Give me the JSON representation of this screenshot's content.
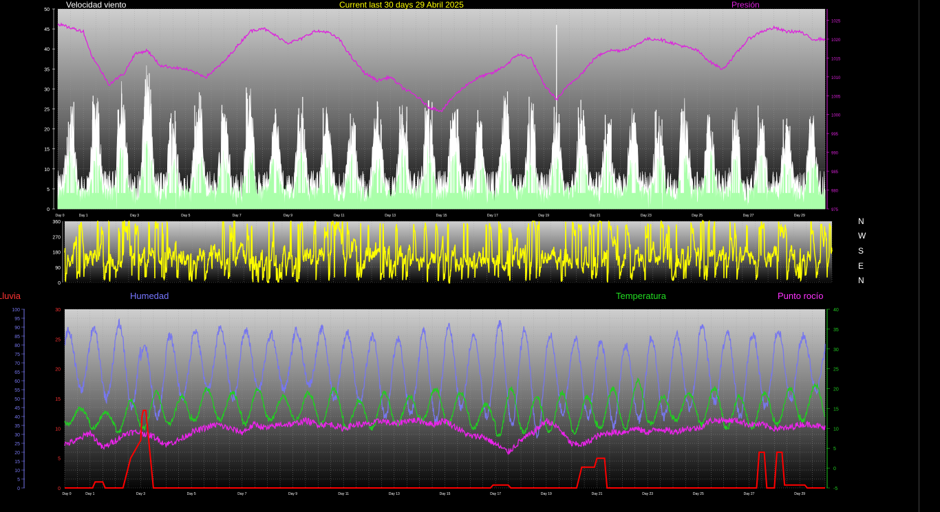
{
  "header": {
    "left_title": "Velocidad viento",
    "center_title": "Current last 30 days 29 Abril 2025",
    "right_title": "Presión"
  },
  "lower_header": {
    "rain": "Lluvia",
    "humidity": "Humedad",
    "temperature": "Temperatura",
    "dewpoint": "Punto rocío"
  },
  "compass": [
    "N",
    "W",
    "S",
    "E",
    "N"
  ],
  "colors": {
    "wind_gust": "#ffffff",
    "wind_avg": "#aaffaa",
    "pressure": "#dd22dd",
    "direction": "#ffff00",
    "humidity": "#7777ee",
    "temperature": "#22cc22",
    "dewpoint": "#ee22ee",
    "rain": "#ff0000",
    "center_title": "#ffff00",
    "rain_label": "#ff3333",
    "humidity_label": "#7777ff",
    "temperature_label": "#22dd22",
    "dewpoint_label": "#ff33ff"
  },
  "chart_data": [
    {
      "type": "line",
      "name": "wind-pressure",
      "y_left_ticks": [
        "50",
        "45",
        "40",
        "35",
        "30",
        "25",
        "20",
        "15",
        "10",
        "5",
        "0"
      ],
      "y_right_ticks": [
        "1025",
        "1020",
        "1015",
        "1010",
        "1005",
        "1000",
        "995",
        "990",
        "985",
        "980",
        "975"
      ],
      "x_ticks": [
        "Day 0",
        "Day 1",
        "Day 3",
        "Day 5",
        "Day 7",
        "Day 9",
        "Day 11",
        "Day 13",
        "Day 15",
        "Day 17",
        "Day 19",
        "Day 21",
        "Day 23",
        "Day 25",
        "Day 27",
        "Day 29"
      ],
      "ylim_left": [
        0,
        50
      ],
      "ylim_right": [
        975,
        1028
      ],
      "xlim": [
        0,
        30
      ],
      "series": [
        {
          "key": "gust",
          "daily_peaks": [
            28,
            30,
            33,
            38,
            26,
            30,
            28,
            31,
            26,
            30,
            27,
            24,
            29,
            27,
            30,
            28,
            25,
            31,
            29,
            26,
            28,
            24,
            26,
            25,
            28,
            26,
            25,
            26,
            24,
            27
          ],
          "color_key": "wind_gust"
        },
        {
          "key": "avg",
          "daily_peaks": [
            15,
            15,
            17,
            19,
            14,
            16,
            15,
            16,
            14,
            16,
            15,
            14,
            15,
            15,
            16,
            15,
            14,
            16,
            15,
            14,
            15,
            14,
            14,
            14,
            15,
            15,
            14,
            14,
            13,
            14
          ],
          "color_key": "wind_avg"
        },
        {
          "key": "pressure",
          "x": [
            0,
            0.5,
            1,
            1.3,
            2,
            2.6,
            3,
            3.5,
            4,
            5,
            5.8,
            6.5,
            7,
            7.5,
            8,
            8.5,
            9,
            9.5,
            10,
            10.5,
            11,
            11.5,
            12,
            12.5,
            13,
            13.5,
            14,
            14.5,
            15,
            15.5,
            16,
            16.5,
            17,
            17.5,
            18,
            18.5,
            19,
            19.5,
            20,
            20.5,
            21,
            21.5,
            22,
            22.5,
            23,
            23.5,
            24,
            24.5,
            25,
            25.5,
            26,
            26.5,
            27,
            27.5,
            28,
            28.5,
            29,
            29.5,
            30
          ],
          "y": [
            1024,
            1023,
            1022,
            1016,
            1008,
            1011,
            1016,
            1017,
            1013,
            1012,
            1010,
            1014,
            1018,
            1022,
            1023,
            1021,
            1019,
            1020,
            1022,
            1022,
            1020,
            1015,
            1011,
            1009,
            1010,
            1007,
            1005,
            1002,
            1001,
            1005,
            1008,
            1010,
            1011,
            1013,
            1016,
            1015,
            1008,
            1004,
            1008,
            1011,
            1015,
            1017,
            1017,
            1018,
            1020,
            1020,
            1019,
            1018,
            1017,
            1014,
            1012,
            1016,
            1020,
            1022,
            1023,
            1022,
            1022,
            1020,
            1020
          ],
          "color_key": "pressure"
        }
      ]
    },
    {
      "type": "line",
      "name": "wind-direction",
      "y_ticks": [
        "360",
        "270",
        "180",
        "90",
        "0"
      ],
      "ylim": [
        0,
        360
      ],
      "series": [
        {
          "key": "direction",
          "color_key": "direction"
        }
      ]
    },
    {
      "type": "line",
      "name": "humidity-temp-dew-rain",
      "y_hum_ticks": [
        "100",
        "95",
        "90",
        "85",
        "80",
        "75",
        "70",
        "65",
        "60",
        "55",
        "50",
        "45",
        "40",
        "35",
        "30",
        "25",
        "20",
        "15",
        "10",
        "5",
        "0"
      ],
      "y_rain_ticks": [
        "30",
        "25",
        "20",
        "15",
        "10",
        "5",
        "0"
      ],
      "y_temp_ticks": [
        "40",
        "35",
        "30",
        "25",
        "20",
        "15",
        "10",
        "5",
        "0",
        "-5"
      ],
      "x_ticks": [
        "Day 0",
        "Day 1",
        "Day 3",
        "Day 5",
        "Day 7",
        "Day 9",
        "Day 11",
        "Day 13",
        "Day 15",
        "Day 17",
        "Day 19",
        "Day 21",
        "Day 23",
        "Day 25",
        "Day 27",
        "Day 29"
      ],
      "ylim_hum": [
        0,
        100
      ],
      "ylim_rain": [
        0,
        30
      ],
      "ylim_temp": [
        -5,
        40
      ],
      "xlim": [
        0,
        30
      ],
      "series": [
        {
          "key": "humidity",
          "daily_max": [
            88,
            90,
            92,
            80,
            85,
            88,
            90,
            88,
            86,
            88,
            89,
            87,
            85,
            83,
            88,
            90,
            85,
            92,
            89,
            86,
            84,
            82,
            80,
            84,
            86,
            90,
            88,
            86,
            88,
            85
          ],
          "daily_min": [
            55,
            50,
            45,
            40,
            50,
            55,
            50,
            55,
            55,
            58,
            50,
            48,
            40,
            42,
            38,
            45,
            40,
            35,
            30,
            42,
            40,
            35,
            38,
            40,
            45,
            48,
            40,
            45,
            50,
            55
          ],
          "color_key": "humidity"
        },
        {
          "key": "temperature",
          "daily_max": [
            15,
            14,
            17,
            19,
            18,
            20,
            19,
            20,
            18,
            19,
            20,
            17,
            19,
            18,
            20,
            19,
            16,
            20,
            18,
            19,
            18,
            20,
            22,
            18,
            19,
            20,
            18,
            19,
            20,
            21
          ],
          "daily_min": [
            11,
            10,
            9,
            10,
            11,
            12,
            12,
            11,
            12,
            12,
            11,
            10,
            10,
            11,
            12,
            11,
            10,
            8,
            9,
            9,
            9,
            10,
            10,
            11,
            12,
            11,
            10,
            10,
            11,
            12
          ],
          "color_key": "temperature"
        },
        {
          "key": "dewpoint",
          "x": [
            0,
            0.5,
            1,
            1.5,
            2,
            2.5,
            3,
            3.5,
            4,
            4.5,
            5,
            5.5,
            6,
            6.5,
            7,
            7.5,
            8,
            8.5,
            9,
            9.5,
            10,
            10.5,
            11,
            11.5,
            12,
            12.5,
            13,
            13.5,
            14,
            14.5,
            15,
            15.5,
            16,
            16.5,
            17,
            17.5,
            18,
            18.5,
            19,
            19.5,
            20,
            20.5,
            21,
            21.5,
            22,
            22.5,
            23,
            23.5,
            24,
            24.5,
            25,
            25.5,
            26,
            26.5,
            27,
            27.5,
            28,
            28.5,
            29,
            29.5,
            30
          ],
          "y": [
            6,
            7,
            9,
            5,
            7,
            9,
            9,
            8,
            6,
            7,
            9,
            10,
            11,
            10,
            9,
            11,
            10,
            11,
            11,
            12,
            11,
            11,
            10,
            11,
            11,
            12,
            11,
            12,
            12,
            11,
            12,
            10,
            8,
            8,
            6,
            4,
            7,
            9,
            12,
            10,
            6,
            6,
            8,
            9,
            9,
            10,
            9,
            10,
            9,
            10,
            10,
            12,
            12,
            12,
            11,
            11,
            10,
            10,
            11,
            11,
            10
          ],
          "color_key": "dewpoint"
        },
        {
          "key": "rain",
          "x": [
            0,
            1.1,
            1.2,
            1.5,
            1.6,
            2.3,
            2.6,
            3.0,
            3.05,
            3.1,
            3.2,
            3.5,
            4,
            5,
            10,
            16.8,
            16.9,
            17.5,
            17.6,
            20.2,
            20.4,
            20.9,
            21.0,
            21.3,
            21.4,
            27.3,
            27.4,
            27.6,
            27.7,
            28.0,
            28.1,
            28.3,
            28.4,
            28.8,
            29.2,
            29.3,
            30
          ],
          "y": [
            0,
            0,
            1,
            1,
            0,
            0,
            5,
            8,
            12,
            13,
            13,
            0,
            0,
            0,
            0,
            0,
            0.5,
            0.5,
            0,
            0,
            3.5,
            3.5,
            5,
            5,
            0,
            0,
            6,
            6,
            0,
            0,
            6,
            6,
            0.5,
            0.5,
            0.5,
            0,
            0
          ],
          "color_key": "rain"
        }
      ]
    }
  ]
}
